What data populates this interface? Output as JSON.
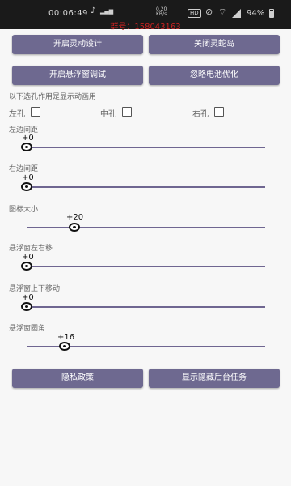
{
  "status_bar": {
    "time": "00:06:49",
    "hd_badge": "HD",
    "battery": "94%",
    "icons": [
      "tiktok-icon",
      "signal-strength-icon",
      "data-speed-icon",
      "hd-icon",
      "dnd-icon",
      "wifi-icon",
      "signal-icon",
      "battery-icon"
    ]
  },
  "group_number": "群号：158043163",
  "buttons": {
    "enable_dynamic_design": "开启灵动设计",
    "close_snake_island": "关闭灵蛇岛",
    "enable_float_debug": "开启悬浮窗调试",
    "ignore_battery": "忽略电池优化",
    "privacy_policy": "隐私政策",
    "show_hide_background": "显示隐藏后台任务"
  },
  "hole_section": {
    "description": "以下选孔作用是显示动画用",
    "options": [
      {
        "label": "左孔",
        "checked": false
      },
      {
        "label": "中孔",
        "checked": false
      },
      {
        "label": "右孔",
        "checked": false
      }
    ]
  },
  "sliders": [
    {
      "label": "左边间距",
      "value_text": "+0",
      "value": 0
    },
    {
      "label": "右边间距",
      "value_text": "+0",
      "value": 0
    },
    {
      "label": "图标大小",
      "value_text": "+20",
      "value": 20
    },
    {
      "label": "悬浮窗左右移",
      "value_text": "+0",
      "value": 0
    },
    {
      "label": "悬浮窗上下移动",
      "value_text": "+0",
      "value": 0
    },
    {
      "label": "悬浮窗圆角",
      "value_text": "+16",
      "value": 16
    }
  ],
  "colors": {
    "button_bg": "#6e6990",
    "track": "#6f6691",
    "group_text": "#cc2222",
    "status_bar_bg": "#1a1a1a"
  }
}
